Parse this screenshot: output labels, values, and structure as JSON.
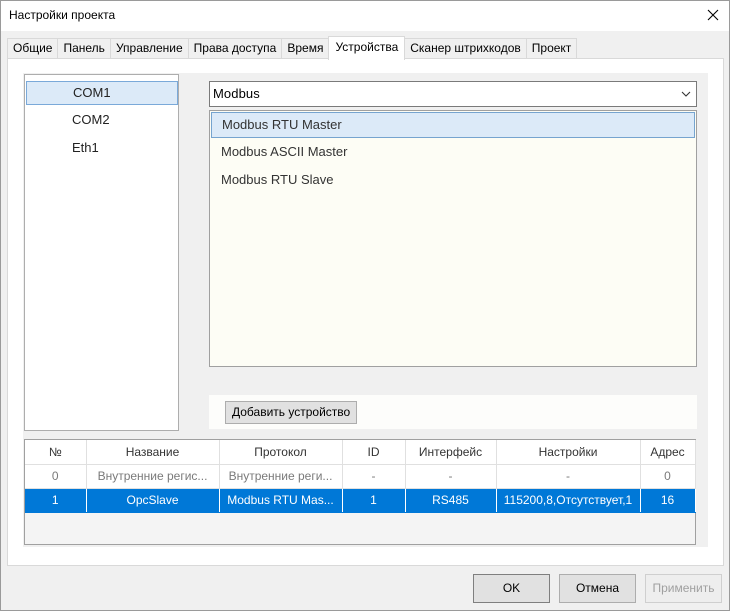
{
  "window": {
    "title": "Настройки проекта",
    "close_icon": "close-icon"
  },
  "tabs": [
    {
      "label": "Общие"
    },
    {
      "label": "Панель"
    },
    {
      "label": "Управление"
    },
    {
      "label": "Права доступа"
    },
    {
      "label": "Время"
    },
    {
      "label": "Устройства",
      "active": true
    },
    {
      "label": "Сканер штрихкодов"
    },
    {
      "label": "Проект"
    }
  ],
  "ports": [
    {
      "label": "COM1",
      "selected": true
    },
    {
      "label": "COM2"
    },
    {
      "label": "Eth1"
    }
  ],
  "protocol_family": {
    "selected": "Modbus",
    "chevron_icon": "chevron-down-icon"
  },
  "protocols": [
    {
      "label": "Modbus RTU Master",
      "selected": true
    },
    {
      "label": "Modbus ASCII Master"
    },
    {
      "label": "Modbus RTU Slave"
    }
  ],
  "add_device_label": "Добавить устройство",
  "devices": {
    "columns": [
      "№",
      "Название",
      "Протокол",
      "ID",
      "Интерфейс",
      "Настройки",
      "Адрес"
    ],
    "rows": [
      [
        "0",
        "Внутренние регис...",
        "Внутренние реги...",
        "-",
        "-",
        "-",
        "0"
      ],
      [
        "1",
        "OpcSlave",
        "Modbus RTU Mas...",
        "1",
        "RS485",
        "115200,8,Отсутствует,1",
        "16"
      ]
    ],
    "selected_row": 1
  },
  "buttons": {
    "ok": "OK",
    "cancel": "Отмена",
    "apply": "Применить"
  },
  "colors": {
    "selection": "#0078d7",
    "list_selection": "#dceaf8"
  }
}
